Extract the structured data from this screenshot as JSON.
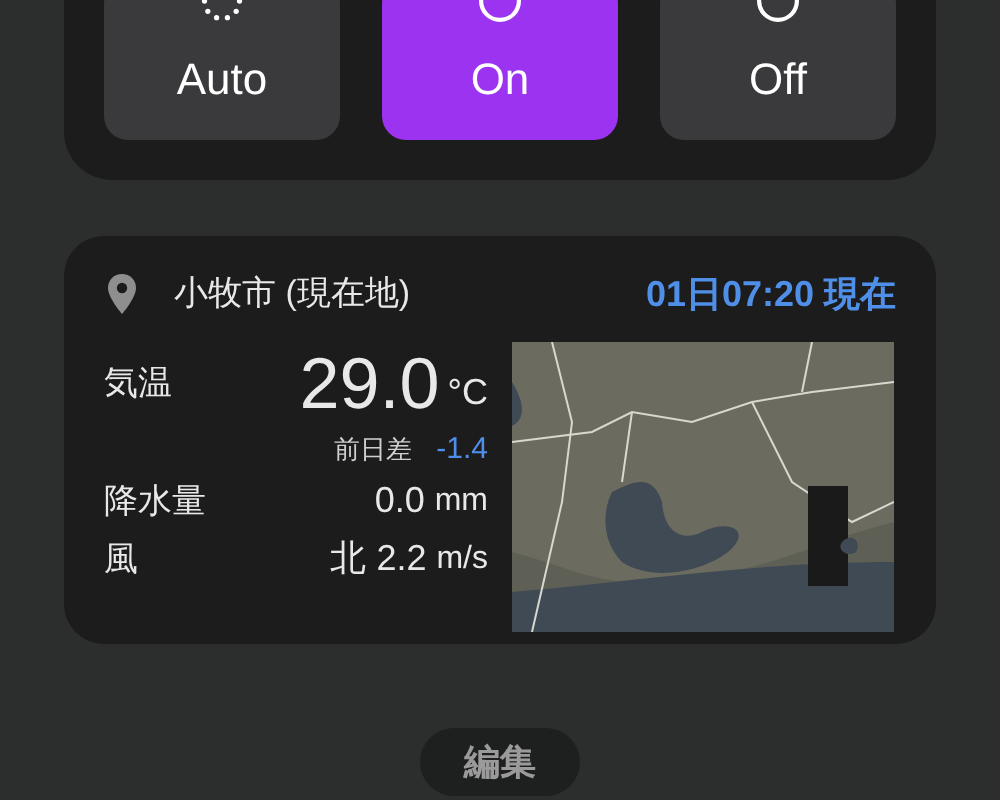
{
  "modes": [
    {
      "label": "Auto",
      "kind": "auto",
      "selected": false
    },
    {
      "label": "On",
      "kind": "on",
      "selected": true
    },
    {
      "label": "Off",
      "kind": "off",
      "selected": false
    }
  ],
  "weather": {
    "location": "小牧市 (現在地)",
    "time": "01日07:20 現在",
    "temperature": {
      "label": "気温",
      "value": "29.0",
      "unit": "°C",
      "diff_label": "前日差",
      "diff": "-1.4"
    },
    "rows": [
      {
        "label": "降水量",
        "value": "0.0",
        "unit": "mm"
      },
      {
        "label": "風",
        "value": "北 2.2",
        "unit": "m/s"
      }
    ]
  },
  "edit_button": "編集"
}
